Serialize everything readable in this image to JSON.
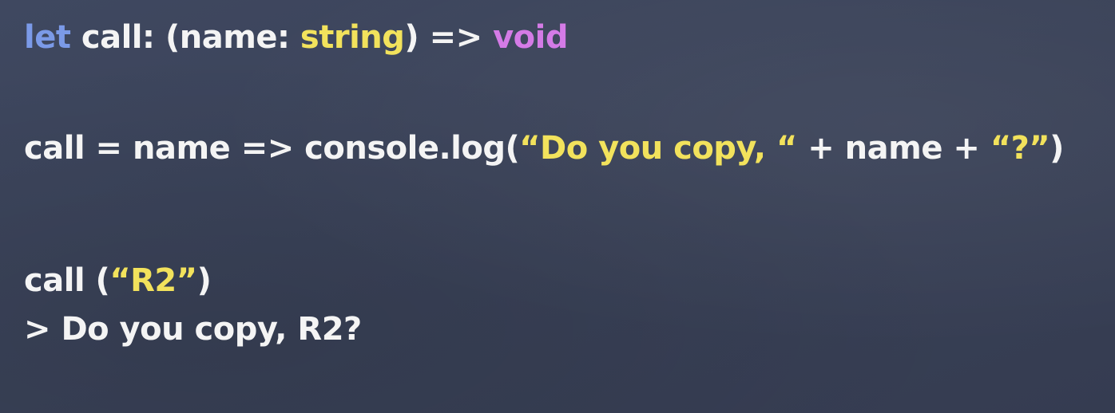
{
  "code": {
    "line1": {
      "keyword": "let",
      "decl": " call: (name: ",
      "param_type": "string",
      "arrow": ") => ",
      "return_type": "void"
    },
    "line2": {
      "prefix": "call = name => console.log(",
      "str1": "“Do you copy, “",
      "plus1": " + name + ",
      "str2": "“?”",
      "suffix": ")"
    },
    "line3": {
      "prefix": "call (",
      "arg": "“R2”",
      "suffix": ")"
    },
    "line4": {
      "output": "> Do you copy, R2?"
    }
  },
  "colors": {
    "background": "#3b4358",
    "text": "#f4f4f4",
    "keyword": "#7b9ae8",
    "type_string": "#f2e25c",
    "type_void": "#d47be6",
    "string_literal": "#f2e25c"
  }
}
